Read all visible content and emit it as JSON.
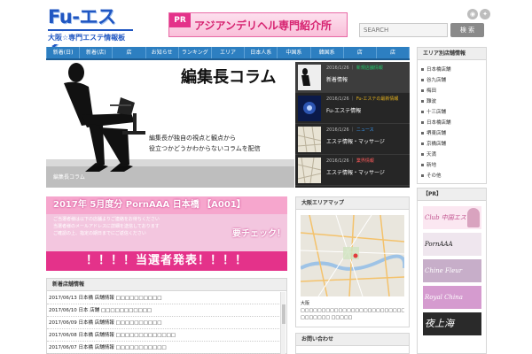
{
  "header": {
    "logo_main": "Fu-エステ",
    "logo_sub": "大阪☆専門エステ情報板",
    "pr_tag": "PR",
    "pr_text": "アジアンデリヘル専門紹介所",
    "search_placeholder": "SEARCH",
    "search_button": "検 索",
    "social_icons": [
      "rss-icon",
      "twitter-icon"
    ]
  },
  "nav": {
    "items": [
      "新着(日)",
      "新着(店)",
      "店",
      "お知らせ",
      "ランキング",
      "エリア",
      "日本人系",
      "中国系",
      "韓国系",
      "店",
      "店"
    ]
  },
  "hero": {
    "title": "編集長コラム",
    "line1": "編集長が独自の視点と観点から",
    "line2": "役立つかどうかわからないコラムを配信",
    "caption": "編集長コラム"
  },
  "news": [
    {
      "date": "2016/1/26",
      "category": "新規店舗情報",
      "category_color": "#23c26a",
      "title": "新着情報"
    },
    {
      "date": "2016/1/26",
      "category": "Fu-エステの最新情報",
      "category_color": "#e6b31e",
      "title": "Fu-エステ情報"
    },
    {
      "date": "2016/1/26",
      "category": "ニュース",
      "category_color": "#3aa0ff",
      "title": "エステ情報・マッサージ"
    },
    {
      "date": "2016/1/26",
      "category": "業界情報",
      "category_color": "#ff5a5a",
      "title": "エステ情報・マッサージ"
    }
  ],
  "campaign": {
    "head": "2017年 5月度分 PornAAA 日本橋 【A001】",
    "lines": [
      "ご当選者様は以下の店舗よりご連絡をお待ちください",
      "当選者様のメールアドレスに詳細を送信しております",
      "ご確認の上、指定の期日までにご返信ください"
    ],
    "check": "要チェック！",
    "winner": "！！！！当選者発表！！！！"
  },
  "new_posts": {
    "title": "新着店舗情報",
    "rows": [
      "2017/06/13 日本橋 店舗情報 □□□□□□□□□□",
      "2017/06/10 日本 店舗 □□□□□□□□□□□",
      "2017/06/09 日本橋 店舗情報 □□□□□□□□□□",
      "2017/06/08 日本橋 店舗情報 □□□□□□□□□□□□□",
      "2017/06/07 日本橋 店舗情報 □□□□□□□□□□□"
    ]
  },
  "access": {
    "title": "大阪エリアマップ",
    "text": "大阪 □□□□□□□□□□□□□□□□□□□□□□□□□□□□□□□□□□□□□□ □□□□□□□ □□□□□"
  },
  "bottom_box": {
    "title": "お問い合わせ"
  },
  "sidebar": {
    "title": "エリア別店舗情報",
    "items": [
      "日本橋店舗",
      "谷九店舗",
      "梅田",
      "難波",
      "十三店舗",
      "日本橋店舗",
      "堺東店舗",
      "京橋店舗",
      "天満",
      "新地",
      "その他"
    ]
  },
  "pr_side": {
    "title": "【PR】",
    "ads": [
      {
        "text": "Club 中国エステ",
        "color": "#c1528e",
        "bg": "#fbe7f1"
      },
      {
        "text": "PornAAA",
        "color": "#1a1a1a",
        "bg": "#efe6ee"
      },
      {
        "text": "Chine Fleur",
        "color": "#ffffff",
        "bg": "#c7aec9"
      },
      {
        "text": "Royal China",
        "color": "#ffffff",
        "bg": "#d59bcf"
      },
      {
        "text": "夜上海",
        "color": "#ffffff",
        "bg": "#2a2a2a"
      }
    ]
  }
}
